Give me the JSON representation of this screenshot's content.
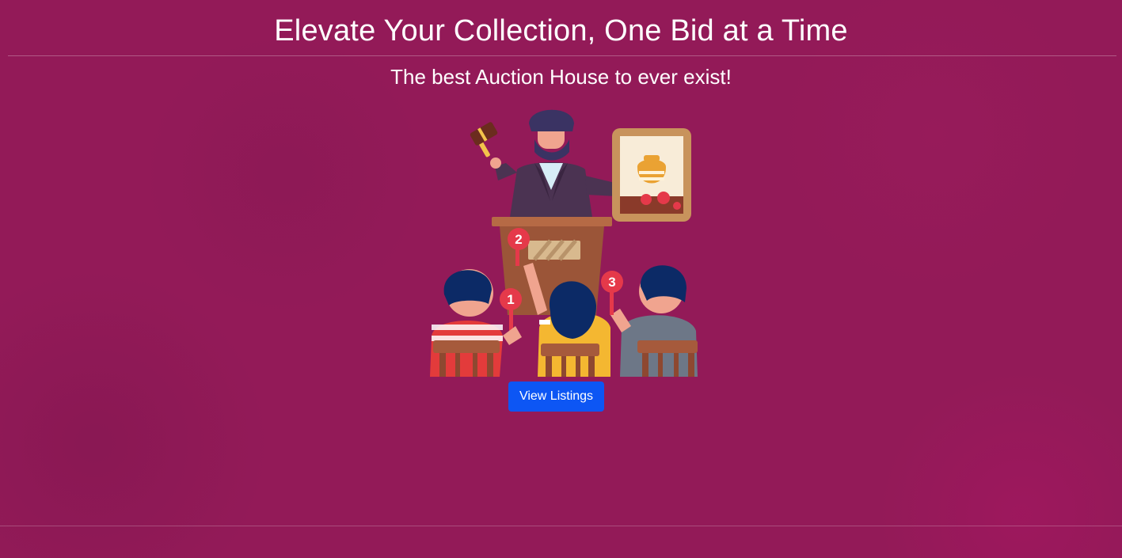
{
  "hero": {
    "title": "Elevate Your Collection, One Bid at a Time",
    "subtitle": "The best Auction House to ever exist!"
  },
  "illustration": {
    "icon": "auction-scene-illustration",
    "paddles": [
      "1",
      "2",
      "3"
    ]
  },
  "actions": {
    "view_listings_label": "View Listings"
  },
  "colors": {
    "background": "#931a58",
    "button": "#0d56f4",
    "text": "#ffffff"
  }
}
